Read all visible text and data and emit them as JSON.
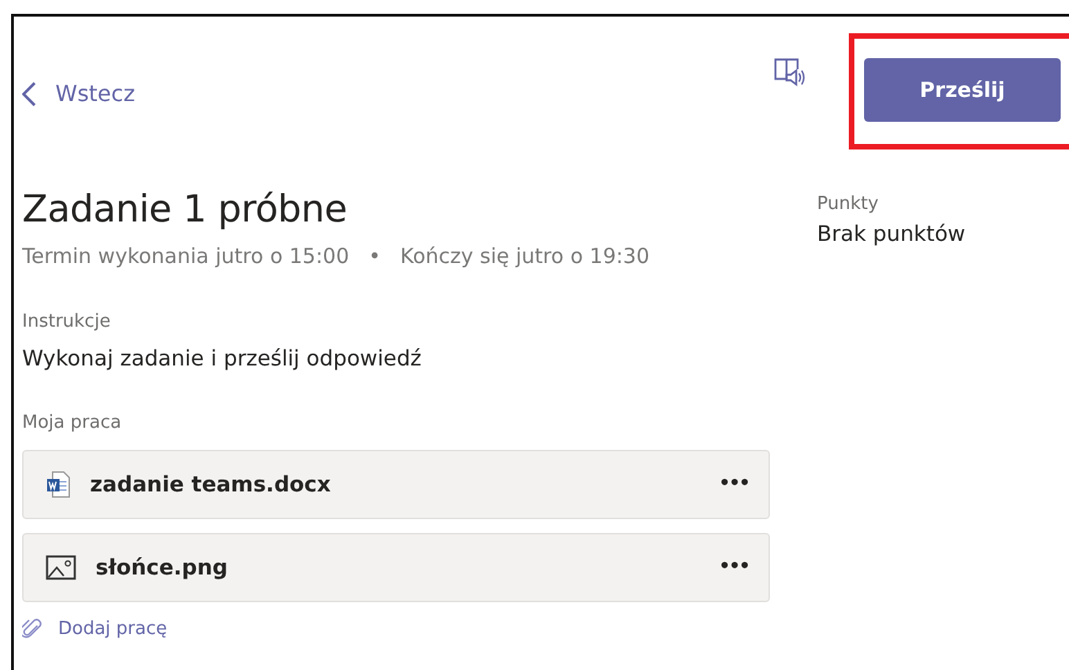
{
  "back_link": {
    "label": "Wstecz"
  },
  "submit_button": {
    "label": "Prześlij",
    "highlighted": true
  },
  "assignment": {
    "title": "Zadanie 1 próbne",
    "due": "Termin wykonania jutro o 15:00",
    "separator": "•",
    "closes": "Kończy się jutro o 19:30"
  },
  "instructions": {
    "label": "Instrukcje",
    "text": "Wykonaj zadanie i prześlij odpowiedź"
  },
  "my_work": {
    "label": "Moja praca",
    "files": [
      {
        "kind": "word",
        "name": "zadanie teams.docx",
        "menu": "•••"
      },
      {
        "kind": "image",
        "name": "słońce.png",
        "menu": "•••"
      }
    ],
    "add_link": "Dodaj pracę"
  },
  "points": {
    "label": "Punkty",
    "value": "Brak punktów"
  }
}
